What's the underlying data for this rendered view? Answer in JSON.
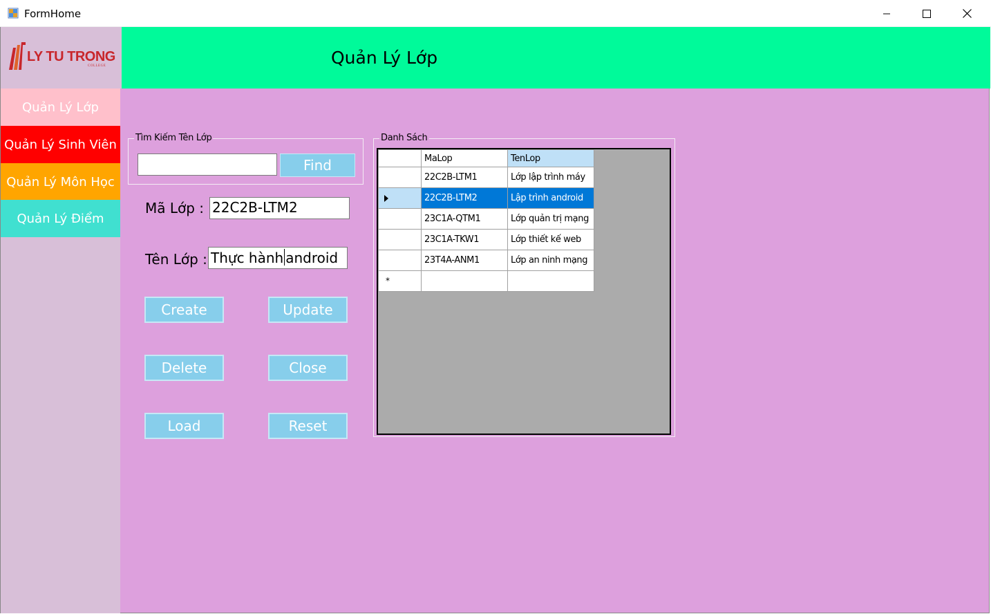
{
  "window": {
    "title": "FormHome",
    "minimize_glyph": "—",
    "maximize_glyph": "☐",
    "close_glyph": "✕"
  },
  "logo": {
    "text": "LY TU TRONG",
    "subtext": "COLLEGE"
  },
  "sidebar": {
    "items": [
      {
        "label": "Quản Lý Lớp",
        "color": "#ffc0cb"
      },
      {
        "label": "Quản Lý Sinh Viên",
        "color": "#ff0000"
      },
      {
        "label": "Quản Lý Môn Học",
        "color": "#ffa500"
      },
      {
        "label": "Quản Lý Điểm",
        "color": "#40e0d0"
      }
    ]
  },
  "header": {
    "title": "Quản Lý Lớp",
    "color": "#00fa9a"
  },
  "search": {
    "legend": "Tìm Kiếm Tên Lớp",
    "value": "",
    "button": "Find"
  },
  "form": {
    "ma_lop_label": "Mã Lớp :",
    "ma_lop_value": "22C2B-LTM2",
    "ten_lop_label": "Tên Lớp :",
    "ten_lop_value_before_caret": "Thực hành",
    "ten_lop_value_after_caret": "android"
  },
  "buttons": {
    "create": "Create",
    "update": "Update",
    "delete": "Delete",
    "close": "Close",
    "load": "Load",
    "reset": "Reset"
  },
  "list": {
    "legend": "Danh Sách",
    "columns": [
      "MaLop",
      "TenLop"
    ],
    "rows": [
      {
        "malop": "22C2B-LTM1",
        "tenlop": "Lớp lập trình máy"
      },
      {
        "malop": "22C2B-LTM2",
        "tenlop": "Lập trình android"
      },
      {
        "malop": "23C1A-QTM1",
        "tenlop": "Lớp quản trị mạng"
      },
      {
        "malop": "23C1A-TKW1",
        "tenlop": "Lớp thiết kế web"
      },
      {
        "malop": "23T4A-ANM1",
        "tenlop": "Lớp an ninh mạng"
      }
    ],
    "selected_index": 1,
    "new_row_marker": "*"
  },
  "colors": {
    "background": "#dda0dd",
    "sidebar": "#d8bfd8",
    "button": "#87ceeb",
    "selection": "#0078d7"
  }
}
